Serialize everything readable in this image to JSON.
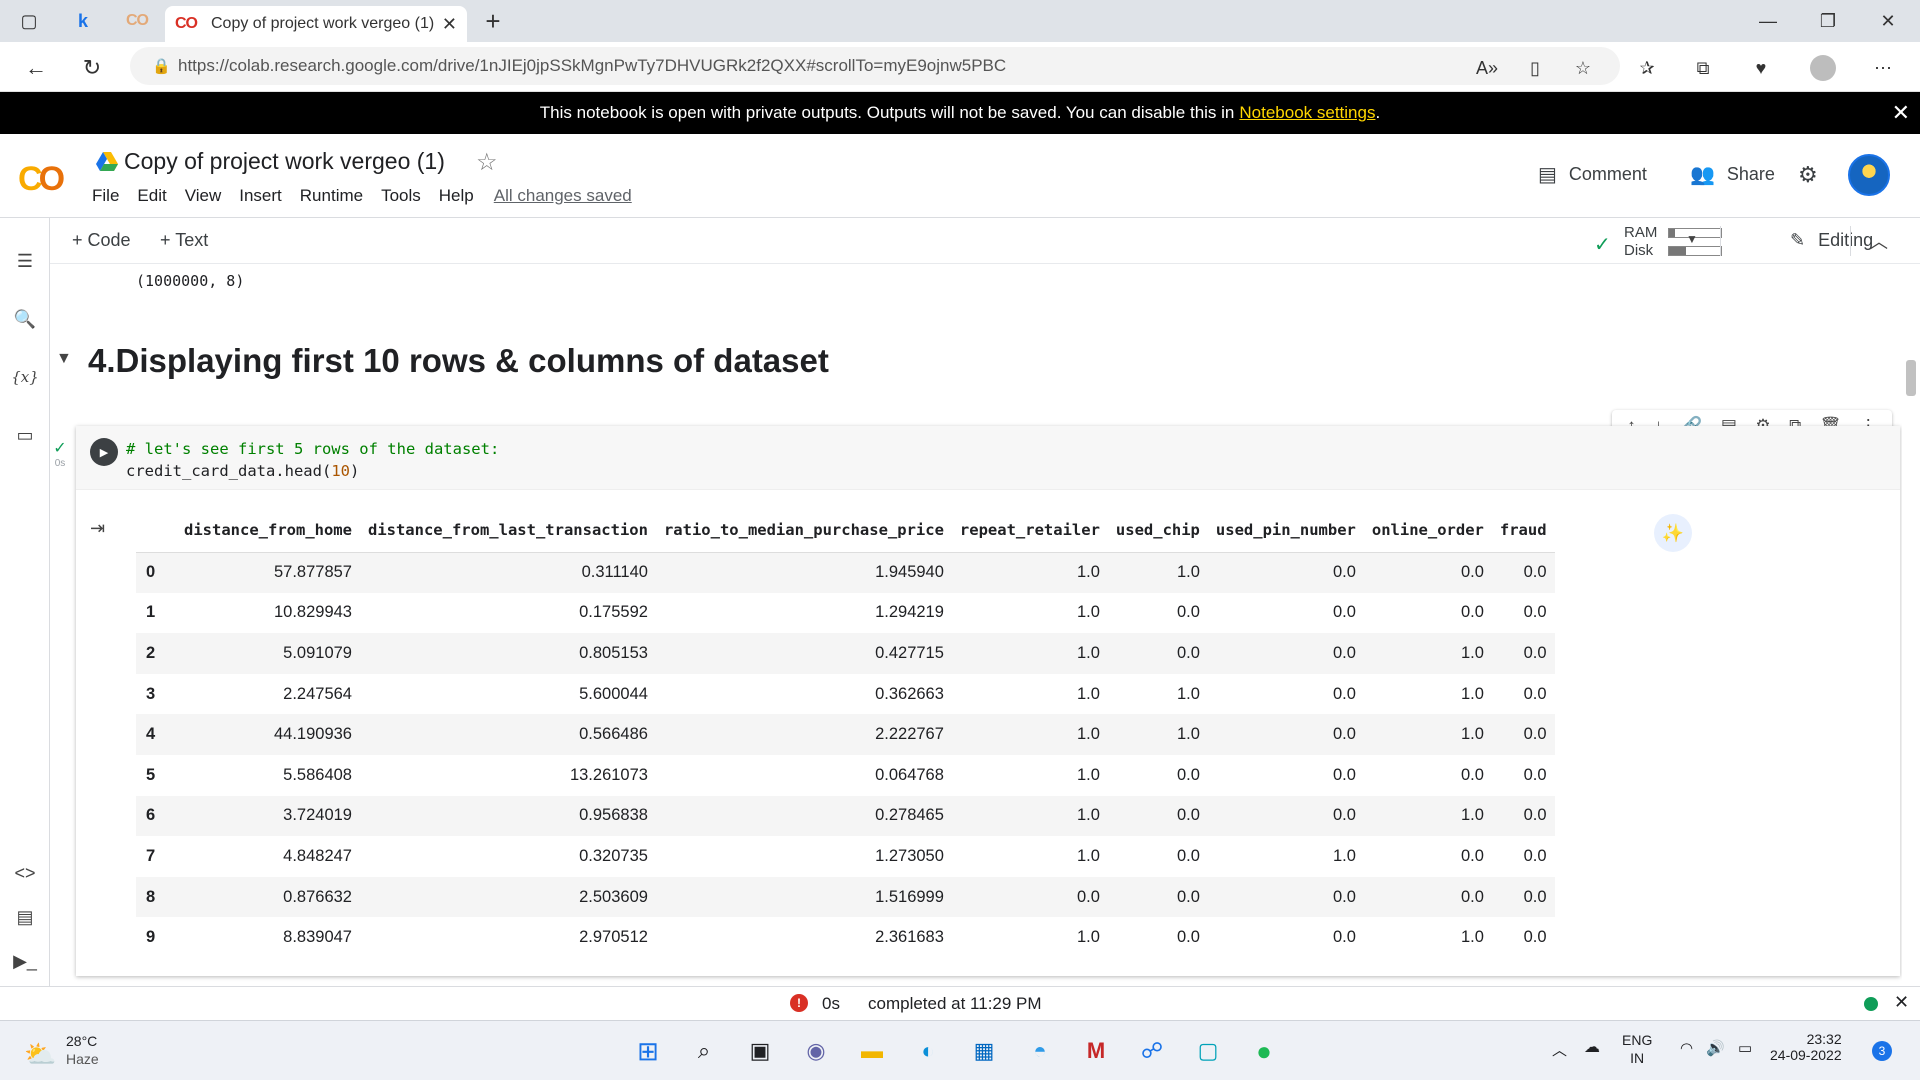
{
  "browser": {
    "tab_title": "Copy of project work vergeo (1)",
    "url": "https://colab.research.google.com/drive/1nJIEj0jpSSkMgnPwTy7DHVUGRk2f2QXX#scrollTo=myE9ojnw5PBC",
    "tab_logo": "CO"
  },
  "banner": {
    "text": "This notebook is open with private outputs. Outputs will not be saved. You can disable this in",
    "link": "Notebook settings",
    "end": "."
  },
  "header": {
    "title": "Copy of project work vergeo (1)",
    "menu": [
      "File",
      "Edit",
      "View",
      "Insert",
      "Runtime",
      "Tools",
      "Help"
    ],
    "saved": "All changes saved",
    "comment": "Comment",
    "share": "Share"
  },
  "toolbar": {
    "code": "+ Code",
    "text": "+ Text",
    "ram": "RAM",
    "disk": "Disk",
    "ram_usage": 0.12,
    "disk_usage": 0.33,
    "editing": "Editing"
  },
  "notebook": {
    "prev_output": "(1000000, 8)",
    "section_title": "4.Displaying first 10 rows & columns of dataset",
    "exec_time": "0s",
    "code_comment": "# let's see first 5 rows of the dataset:",
    "code_call": "credit_card_data.head(",
    "code_arg": "10",
    "code_close": ")",
    "columns": [
      "",
      "distance_from_home",
      "distance_from_last_transaction",
      "ratio_to_median_purchase_price",
      "repeat_retailer",
      "used_chip",
      "used_pin_number",
      "online_order",
      "fraud"
    ],
    "rows": [
      [
        "0",
        "57.877857",
        "0.311140",
        "1.945940",
        "1.0",
        "1.0",
        "0.0",
        "0.0",
        "0.0"
      ],
      [
        "1",
        "10.829943",
        "0.175592",
        "1.294219",
        "1.0",
        "0.0",
        "0.0",
        "0.0",
        "0.0"
      ],
      [
        "2",
        "5.091079",
        "0.805153",
        "0.427715",
        "1.0",
        "0.0",
        "0.0",
        "1.0",
        "0.0"
      ],
      [
        "3",
        "2.247564",
        "5.600044",
        "0.362663",
        "1.0",
        "1.0",
        "0.0",
        "1.0",
        "0.0"
      ],
      [
        "4",
        "44.190936",
        "0.566486",
        "2.222767",
        "1.0",
        "1.0",
        "0.0",
        "1.0",
        "0.0"
      ],
      [
        "5",
        "5.586408",
        "13.261073",
        "0.064768",
        "1.0",
        "0.0",
        "0.0",
        "0.0",
        "0.0"
      ],
      [
        "6",
        "3.724019",
        "0.956838",
        "0.278465",
        "1.0",
        "0.0",
        "0.0",
        "1.0",
        "0.0"
      ],
      [
        "7",
        "4.848247",
        "0.320735",
        "1.273050",
        "1.0",
        "0.0",
        "1.0",
        "0.0",
        "0.0"
      ],
      [
        "8",
        "0.876632",
        "2.503609",
        "1.516999",
        "0.0",
        "0.0",
        "0.0",
        "0.0",
        "0.0"
      ],
      [
        "9",
        "8.839047",
        "2.970512",
        "2.361683",
        "1.0",
        "0.0",
        "0.0",
        "1.0",
        "0.0"
      ]
    ]
  },
  "status": {
    "time": "0s",
    "completed": "completed at 11:29 PM"
  },
  "taskbar": {
    "temp": "28°C",
    "weather": "Haze",
    "lang1": "ENG",
    "lang2": "IN",
    "time": "23:32",
    "date": "24-09-2022",
    "badge": "3"
  },
  "colors": {
    "accent": "#1a73e8",
    "colab_orange": "#e8710a",
    "colab_yellow": "#f9ab00",
    "code_comment": "#008000",
    "number": "#aa5500"
  }
}
